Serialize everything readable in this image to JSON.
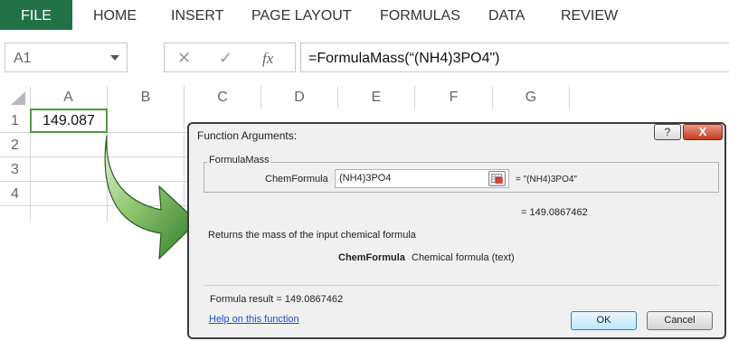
{
  "ribbon": {
    "tabs": [
      "FILE",
      "HOME",
      "INSERT",
      "PAGE LAYOUT",
      "FORMULAS",
      "DATA",
      "REVIEW"
    ],
    "file_color": "#217346"
  },
  "formula_bar": {
    "name_box": "A1",
    "cancel_icon": "x-icon",
    "enter_icon": "check-icon",
    "fx_label": "fx",
    "formula": "=FormulaMass(“(NH4)3PO4\")"
  },
  "grid": {
    "columns": [
      "A",
      "B",
      "C",
      "D",
      "E",
      "F",
      "G"
    ],
    "rows": [
      "1",
      "2",
      "3",
      "4"
    ],
    "cell_a1": "149.087",
    "selection_color": "#4f9a3e"
  },
  "dialog": {
    "title": "Function Arguments:",
    "help_button": "?",
    "close_button": "X",
    "function_name": "FormulaMass",
    "argument_name": "ChemFormula",
    "argument_value": "(NH4)3PO4",
    "argument_evaluated": "= \"(NH4)3PO4\"",
    "result_value": "= 149.0867462",
    "description": "Returns the mass of the input chemical formula",
    "argument_desc_name": "ChemFormula",
    "argument_desc": "Chemical formula (text)",
    "formula_result": "Formula result = 149.0867462",
    "help_link": "Help on this function",
    "ok_label": "OK",
    "cancel_label": "Cancel"
  }
}
